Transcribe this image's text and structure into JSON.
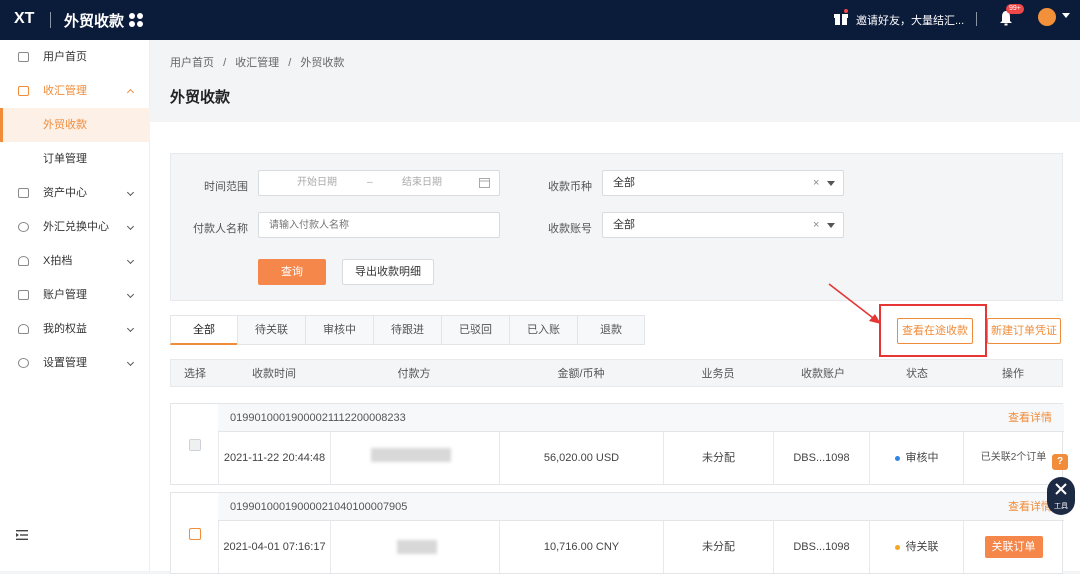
{
  "topbar": {
    "logo": "XT",
    "app_title": "外贸收款",
    "invite": "邀请好友，大量结汇...",
    "badge": "99+"
  },
  "sidebar": {
    "items": [
      {
        "label": "用户首页"
      },
      {
        "label": "收汇管理"
      },
      {
        "label": "外贸收款"
      },
      {
        "label": "订单管理"
      },
      {
        "label": "资产中心"
      },
      {
        "label": "外汇兑换中心"
      },
      {
        "label": "X拍档"
      },
      {
        "label": "账户管理"
      },
      {
        "label": "我的权益"
      },
      {
        "label": "设置管理"
      }
    ]
  },
  "breadcrumb": {
    "home": "用户首页",
    "sep": "/",
    "section": "收汇管理",
    "current": "外贸收款"
  },
  "page_title": "外贸收款",
  "filter": {
    "time_range_label": "时间范围",
    "start_placeholder": "开始日期",
    "range_sep": "–",
    "end_placeholder": "结束日期",
    "currency_label": "收款币种",
    "currency_value": "全部",
    "payer_label": "付款人名称",
    "payer_placeholder": "请输入付款人名称",
    "account_label": "收款账号",
    "account_value": "全部",
    "query_label": "查询",
    "export_label": "导出收款明细"
  },
  "tabs": [
    "全部",
    "待关联",
    "审核中",
    "待跟进",
    "已驳回",
    "已入账",
    "退款"
  ],
  "actions": {
    "transit_label": "查看在途收款",
    "new_label": "新建订单凭证"
  },
  "table": {
    "headers": [
      "选择",
      "收款时间",
      "付款方",
      "金额/币种",
      "业务员",
      "收款账户",
      "状态",
      "操作"
    ],
    "rows": [
      {
        "order_no": "01990100019000021112200008233",
        "detail": "查看详情",
        "time": "2021-11-22 20:44:48",
        "amount": "56,020.00 USD",
        "salesperson": "未分配",
        "account": "DBS...1098",
        "status": "审核中",
        "status_color": "#2f86e8",
        "op": "已关联2个订单"
      },
      {
        "order_no": "01990100019000021040100007905",
        "detail": "查看详情",
        "time": "2021-04-01 07:16:17",
        "amount": "10,716.00 CNY",
        "salesperson": "未分配",
        "account": "DBS...1098",
        "status": "待关联",
        "status_color": "#f5a623",
        "op": "关联订单"
      }
    ]
  },
  "float": {
    "help": "?",
    "tools": "工具"
  }
}
